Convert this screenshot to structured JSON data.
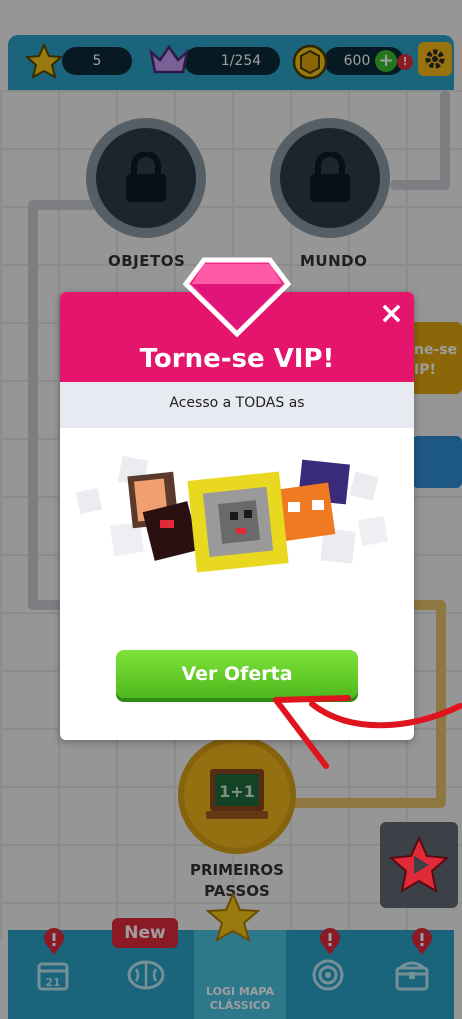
{
  "topbar": {
    "stars_value": "5",
    "crowns_value": "1/254",
    "coins_value": "600",
    "plus_label": "+",
    "alert_mark": "!"
  },
  "map": {
    "nodes": [
      {
        "label": "OBJETOS"
      },
      {
        "label": "MUNDO"
      }
    ],
    "side_text": "ne-se\nIP!",
    "lesson_label": "PRIMEIROS PASSOS"
  },
  "modal": {
    "title": "Torne-se VIP!",
    "subtitle": "Acesso a TODAS as",
    "close_label": "×",
    "offer_button": "Ver Oferta"
  },
  "bottom_nav": {
    "new_badge": "New",
    "calendar_day": "21",
    "active_tab_label": "LOGI MAPA CLÁSSICO"
  },
  "colors": {
    "topbar": "#2aa3c9",
    "modal_head": "#e5156e",
    "offer_button": "#5cc826",
    "arrow": "#e0141e"
  }
}
